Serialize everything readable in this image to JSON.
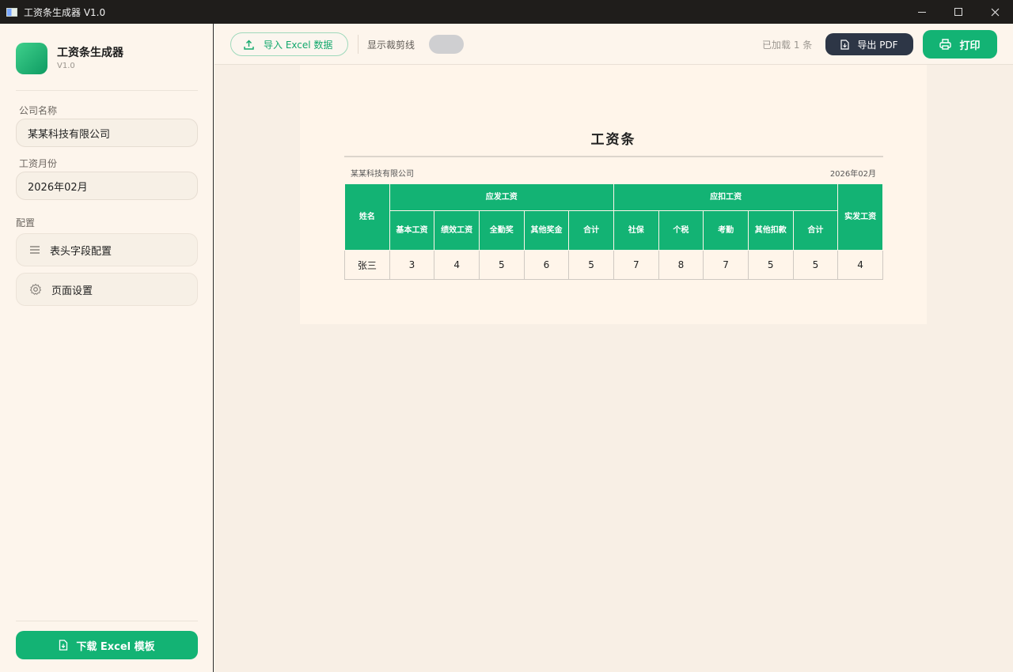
{
  "window": {
    "title": "工资条生成器 V1.0"
  },
  "sidebar": {
    "app_name": "工资条生成器",
    "app_version": "V1.0",
    "company_label": "公司名称",
    "company_value": "某某科技有限公司",
    "month_label": "工资月份",
    "month_value": "2026年02月",
    "config_section": "配置",
    "menu": [
      {
        "label": "表头字段配置",
        "icon": "list-icon"
      },
      {
        "label": "页面设置",
        "icon": "gear-icon"
      }
    ],
    "download_label": "下载 Excel 模板"
  },
  "toolbar": {
    "import_label": "导入 Excel 数据",
    "cut_line_label": "显示裁剪线",
    "cut_line_on": false,
    "loaded_text": "已加载 1 条",
    "export_pdf_label": "导出 PDF",
    "print_label": "打印"
  },
  "slip": {
    "title": "工资条",
    "company": "某某科技有限公司",
    "month": "2026年02月",
    "header": {
      "name": "姓名",
      "earn_group": "应发工资",
      "deduct_group": "应扣工资",
      "net": "实发工资",
      "earn_cols": [
        "基本工资",
        "绩效工资",
        "全勤奖",
        "其他奖金",
        "合计"
      ],
      "deduct_cols": [
        "社保",
        "个税",
        "考勤",
        "其他扣款",
        "合计"
      ]
    },
    "rows": [
      {
        "name": "张三",
        "cells": [
          "3",
          "4",
          "5",
          "6",
          "5",
          "7",
          "8",
          "7",
          "5",
          "5",
          "4"
        ]
      }
    ]
  },
  "colors": {
    "accent": "#13b374",
    "dark_button": "#2d3646",
    "background": "#fdf5ec"
  }
}
